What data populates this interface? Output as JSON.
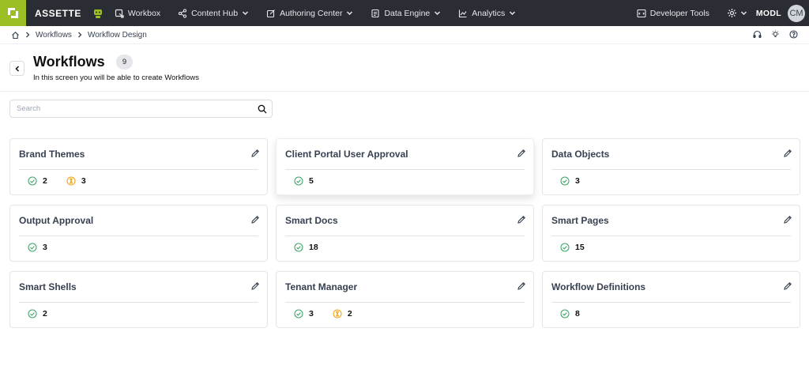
{
  "app": {
    "brand": "ASSETTE",
    "org": "MODL",
    "user_initials": "CM"
  },
  "nav": {
    "items": [
      {
        "label": "Workbox",
        "icon": "workbox-icon",
        "dropdown": false
      },
      {
        "label": "Content Hub",
        "icon": "share-icon",
        "dropdown": true
      },
      {
        "label": "Authoring Center",
        "icon": "edit-square-icon",
        "dropdown": true
      },
      {
        "label": "Data Engine",
        "icon": "document-icon",
        "dropdown": true
      },
      {
        "label": "Analytics",
        "icon": "line-chart-icon",
        "dropdown": true
      }
    ],
    "developer_tools": "Developer Tools"
  },
  "breadcrumb": {
    "items": [
      "Workflows",
      "Workflow Design"
    ]
  },
  "page": {
    "title": "Workflows",
    "count": "9",
    "subtitle": "In this screen you will be able to create Workflows"
  },
  "search": {
    "placeholder": "Search",
    "value": ""
  },
  "colors": {
    "accent": "#9cbf23",
    "topbar": "#2a2d33",
    "check": "#3fa66b",
    "pending": "#f2a51a"
  },
  "cards": [
    {
      "title": "Brand Themes",
      "approved": "2",
      "pending": "3"
    },
    {
      "title": "Client Portal User Approval",
      "approved": "5",
      "pending": null
    },
    {
      "title": "Data Objects",
      "approved": "3",
      "pending": null
    },
    {
      "title": "Output Approval",
      "approved": "3",
      "pending": null
    },
    {
      "title": "Smart Docs",
      "approved": "18",
      "pending": null
    },
    {
      "title": "Smart Pages",
      "approved": "15",
      "pending": null
    },
    {
      "title": "Smart Shells",
      "approved": "2",
      "pending": null
    },
    {
      "title": "Tenant Manager",
      "approved": "3",
      "pending": "2"
    },
    {
      "title": "Workflow Definitions",
      "approved": "8",
      "pending": null
    }
  ]
}
